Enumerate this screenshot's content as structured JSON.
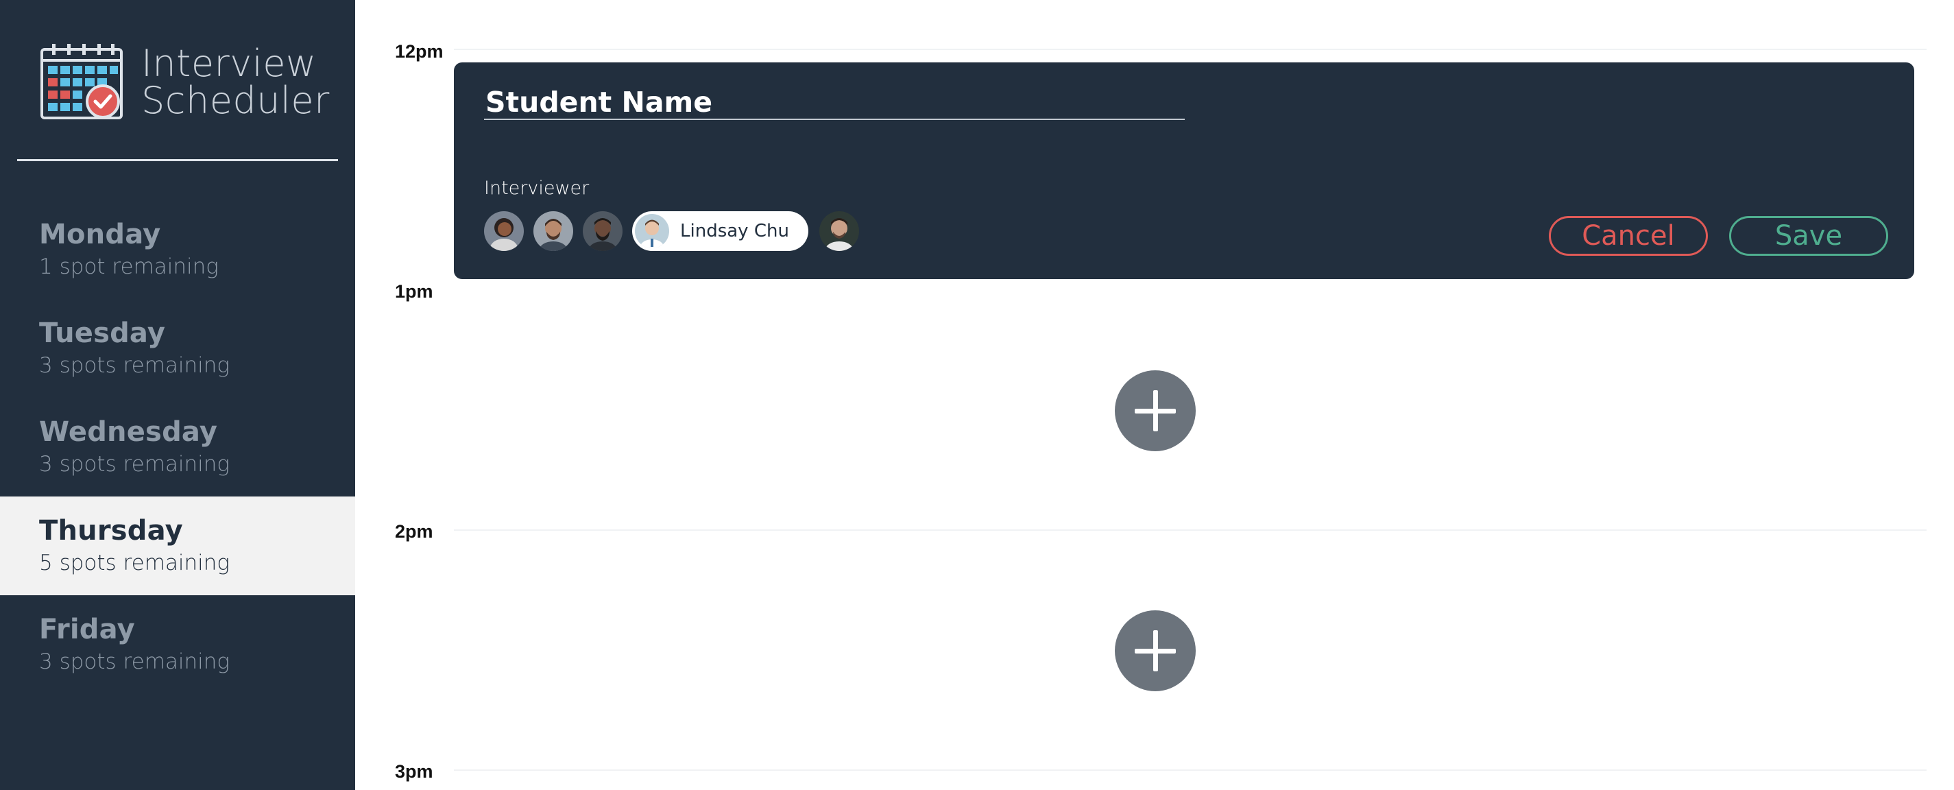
{
  "app": {
    "title_line1": "Interview",
    "title_line2": "Scheduler",
    "logo_icon": "calendar-check-icon"
  },
  "sidebar": {
    "days": [
      {
        "name": "Monday",
        "spots": "1 spot remaining",
        "selected": false
      },
      {
        "name": "Tuesday",
        "spots": "3 spots remaining",
        "selected": false
      },
      {
        "name": "Wednesday",
        "spots": "3 spots remaining",
        "selected": false
      },
      {
        "name": "Thursday",
        "spots": "5 spots remaining",
        "selected": true
      },
      {
        "name": "Friday",
        "spots": "3 spots remaining",
        "selected": false
      }
    ]
  },
  "schedule": {
    "times": [
      "12pm",
      "1pm",
      "2pm",
      "3pm"
    ]
  },
  "form": {
    "student_placeholder": "Student Name",
    "student_value": "",
    "interviewer_label": "Interviewer",
    "selected_interviewer": "Lindsay Chu",
    "cancel_label": "Cancel",
    "save_label": "Save"
  },
  "colors": {
    "sidebar_bg": "#222f3e",
    "selected_day_bg": "#f2f2f2",
    "cancel": "#e05a57",
    "save": "#4fae8f",
    "add_button": "#6b737c"
  }
}
